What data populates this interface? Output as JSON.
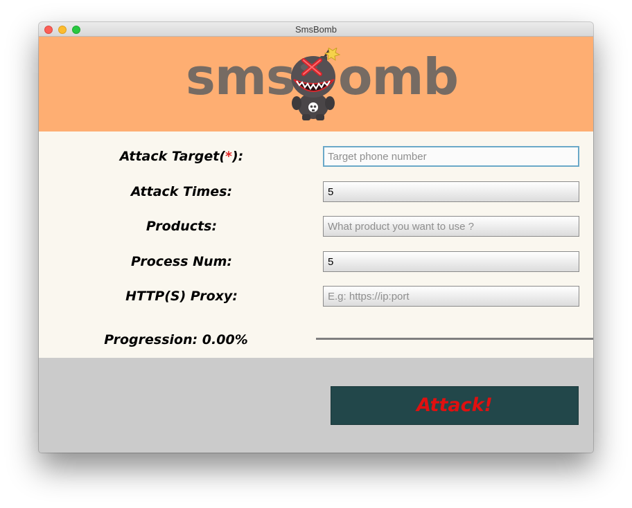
{
  "window": {
    "title": "SmsBomb"
  },
  "banner": {
    "logo_left": "sms",
    "logo_right": "omb"
  },
  "form": {
    "fields": [
      {
        "label_main": "Attack Target(",
        "label_req": "*",
        "label_end": "):",
        "value": "",
        "placeholder": "Target phone number"
      },
      {
        "label": "Attack Times:",
        "value": "5",
        "placeholder": ""
      },
      {
        "label": "Products:",
        "value": "",
        "placeholder": "What product you want to use ?"
      },
      {
        "label": "Process Num:",
        "value": "5",
        "placeholder": ""
      },
      {
        "label": "HTTP(S) Proxy:",
        "value": "",
        "placeholder": "E.g: https://ip:port"
      }
    ],
    "progress": {
      "label": "Progression: 0.00%",
      "fraction": 0.0
    }
  },
  "actions": {
    "attack_label": "Attack!"
  },
  "colors": {
    "banner": "#feae72",
    "form_bg": "#faf7ef",
    "bottom_bg": "#cbcbcb",
    "button_bg": "#22474a",
    "button_text": "#e01010",
    "logo_text": "#766b63"
  }
}
